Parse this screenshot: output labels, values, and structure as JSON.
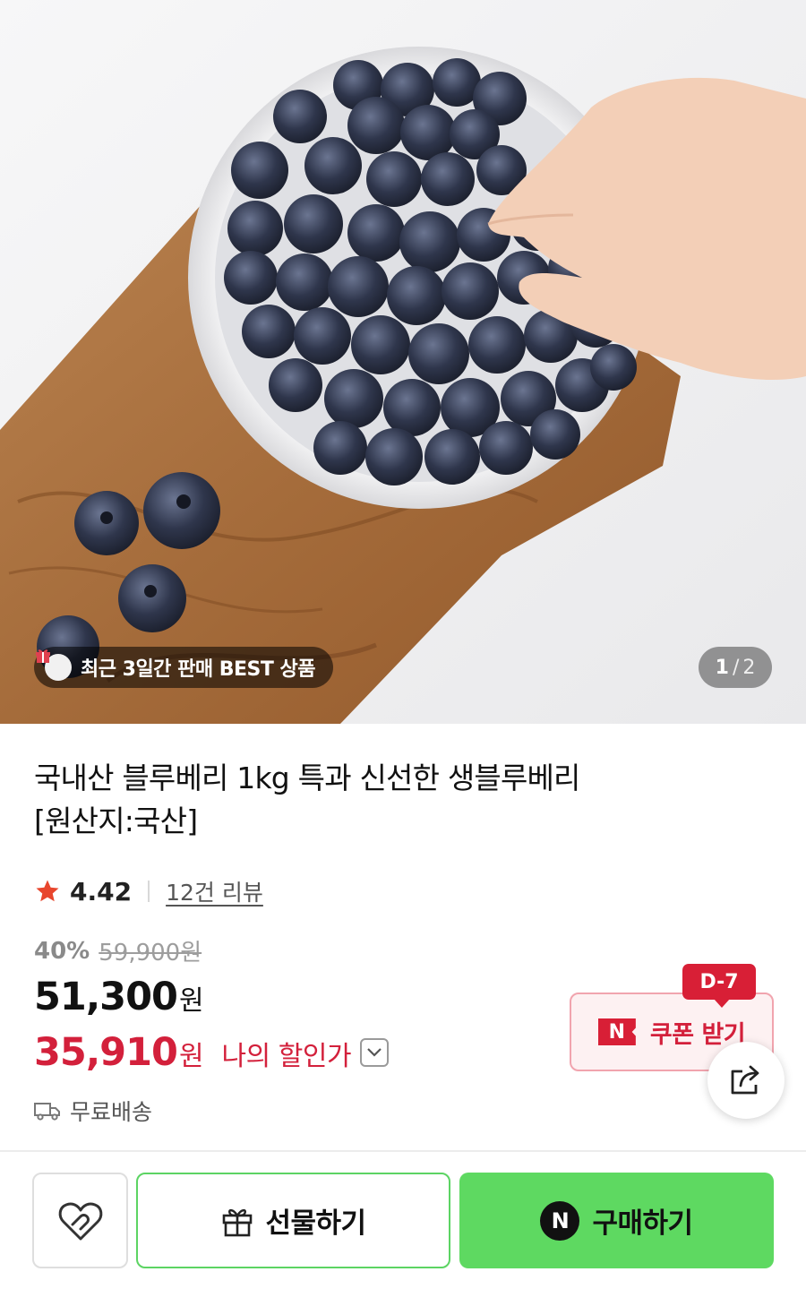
{
  "hero": {
    "badge_text": "최근 3일간 판매 BEST 상품",
    "counter_current": "1",
    "counter_separator": "/",
    "counter_total": "2"
  },
  "product": {
    "title_line1": "국내산 블루베리 1kg 특과 신선한 생블루베리",
    "title_line2": "[원산지:국산]",
    "rating": "4.42",
    "reviews_label": "12건 리뷰",
    "discount_percent": "40%",
    "original_price": "59,900원",
    "sale_price": "51,300",
    "currency": "원",
    "my_price": "35,910",
    "my_price_label": "나의 할인가",
    "shipping": "무료배송"
  },
  "coupon": {
    "dday": "D-7",
    "n_mark": "N",
    "label": "쿠폰 받기"
  },
  "actions": {
    "gift_label": "선물하기",
    "buy_mark": "N",
    "buy_label": "구매하기"
  },
  "colors": {
    "accent_red": "#d3203b",
    "buy_green": "#5ed961",
    "star_red": "#e8462d"
  },
  "icons": [
    "gift-icon",
    "star-icon",
    "chevron-down-icon",
    "truck-icon",
    "share-icon",
    "heart-icon",
    "gift-box-icon",
    "naver-n-icon"
  ]
}
